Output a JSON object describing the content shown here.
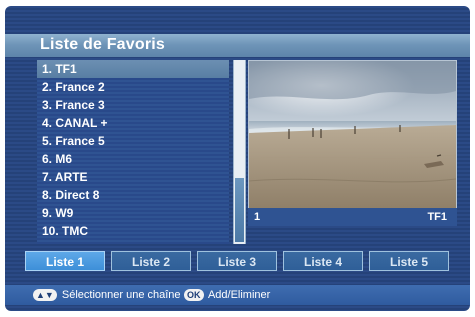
{
  "header": {
    "title": "Liste de Favoris"
  },
  "channels": [
    {
      "label": "1. TF1"
    },
    {
      "label": "2. France 2"
    },
    {
      "label": "3. France 3"
    },
    {
      "label": "4. CANAL +"
    },
    {
      "label": "5. France 5"
    },
    {
      "label": "6. M6"
    },
    {
      "label": "7. ARTE"
    },
    {
      "label": "8. Direct 8"
    },
    {
      "label": "9. W9"
    },
    {
      "label": "10. TMC"
    }
  ],
  "preview": {
    "channel_number": "1",
    "channel_name": "TF1",
    "image": "beach-scene"
  },
  "tabs": [
    {
      "label": "Liste 1",
      "active": true
    },
    {
      "label": "Liste 2",
      "active": false
    },
    {
      "label": "Liste 3",
      "active": false
    },
    {
      "label": "Liste 4",
      "active": false
    },
    {
      "label": "Liste 5",
      "active": false
    }
  ],
  "hints": {
    "select_icon": "up-down-buttons-icon",
    "select_label": "Sélectionner une chaîne",
    "ok_icon_text": "OK",
    "ok_label": "Add/Eliminer"
  },
  "colors": {
    "background": "#2b4a86",
    "title_bar": "#7aa0c3",
    "selected_row": "#6c8fb2",
    "active_tab": "#4c9be0"
  },
  "selection": {
    "selected_index": 0
  }
}
